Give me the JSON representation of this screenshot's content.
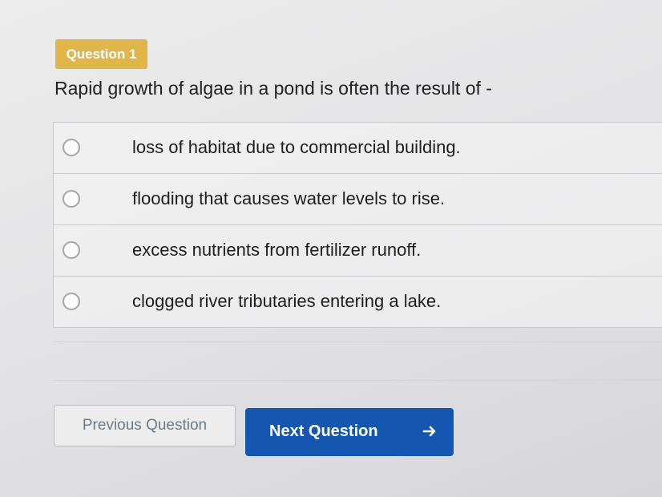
{
  "question": {
    "badge": "Question 1",
    "text": "Rapid growth of algae in a pond is often the result of -"
  },
  "options": [
    {
      "label": "loss of habitat due to commercial building."
    },
    {
      "label": "flooding that causes water levels to rise."
    },
    {
      "label": "excess nutrients from fertilizer runoff."
    },
    {
      "label": "clogged river tributaries entering a lake."
    }
  ],
  "nav": {
    "previous_label": "Previous Question",
    "next_label": "Next Question",
    "next_icon": "arrow-right-icon"
  },
  "colors": {
    "badge": "#e0b54a",
    "next_button": "#1556b0"
  }
}
